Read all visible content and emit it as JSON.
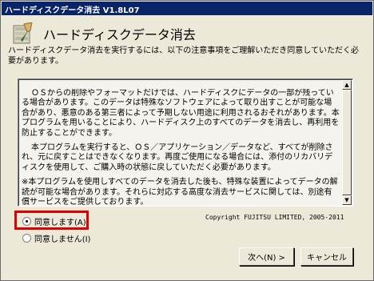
{
  "window": {
    "title": "ハードディスクデータ消去 V1.8L07"
  },
  "header": {
    "title": "ハードディスクデータ消去",
    "description": "ハードディスクデータ消去を実行するには、以下の注意事項をご理解いただき同意していただく必要があります。",
    "icon": "eraser-disk-icon"
  },
  "license": {
    "paragraphs": [
      "ＯＳからの削除やフォーマットだけでは、ハードディスクにデータの一部が残っている場合があります。このデータは特殊なソフトウェアによって取り出すことが可能な場合があり、悪意のある第三者によって予期しない用途に利用されるおそれがあります。本プログラムを用いることにより、ハードディスク上のすべてのデータを消去し、再利用を防止することができます。",
      "本プログラムを実行すると、ＯＳ／アプリケーション／データなど、すべてが削除され、元に戻すことはできなくなります。再度ご使用になる場合には、添付のリカバリディスクを使用して、ご購入時の状態に戻していただく必要があります。"
    ],
    "note": "※本プログラムを使用しすべてのデータを消去した後も、特殊な装置によってデータの解読が可能な場合があります。それらに対応する高度な消去サービスに関しては、別途有償サービスをご提供しております。"
  },
  "copyright": "Copyright FUJITSU LIMITED, 2005-2011",
  "options": {
    "agree": "同意します(A)",
    "disagree": "同意しません(I)",
    "selected": "agree"
  },
  "buttons": {
    "next": "次へ(N) >",
    "cancel": "キャンセル"
  },
  "colors": {
    "titlebar": "#0a246a",
    "highlight": "#e00000",
    "dialog_bg": "#ece9d8"
  }
}
